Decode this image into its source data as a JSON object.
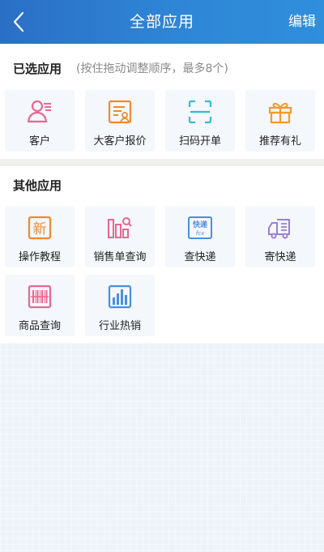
{
  "header": {
    "title": "全部应用",
    "edit_label": "编辑"
  },
  "selected": {
    "title": "已选应用",
    "hint": "(按住拖动调整顺序，最多8个)",
    "apps": [
      {
        "label": "客户",
        "icon": "customer-icon"
      },
      {
        "label": "大客户报价",
        "icon": "quote-icon"
      },
      {
        "label": "扫码开单",
        "icon": "scan-icon"
      },
      {
        "label": "推荐有礼",
        "icon": "gift-icon"
      }
    ]
  },
  "other": {
    "title": "其他应用",
    "apps": [
      {
        "label": "操作教程",
        "icon": "tutorial-icon",
        "glyph": "新"
      },
      {
        "label": "销售单查询",
        "icon": "sales-query-icon"
      },
      {
        "label": "查快递",
        "icon": "express-query-icon",
        "glyph": "快递",
        "sub": "fcx"
      },
      {
        "label": "寄快递",
        "icon": "send-express-icon"
      },
      {
        "label": "商品查询",
        "icon": "product-query-icon"
      },
      {
        "label": "行业热销",
        "icon": "industry-hot-icon"
      }
    ]
  },
  "colors": {
    "header_start": "#2a6fc6",
    "header_end": "#2f8fdc",
    "pink": "#e9678f",
    "orange": "#f0892f",
    "cyan": "#2dbfd0",
    "blue": "#4a8fe0",
    "purple": "#9a7fd6",
    "gift": "#f29b2b"
  }
}
